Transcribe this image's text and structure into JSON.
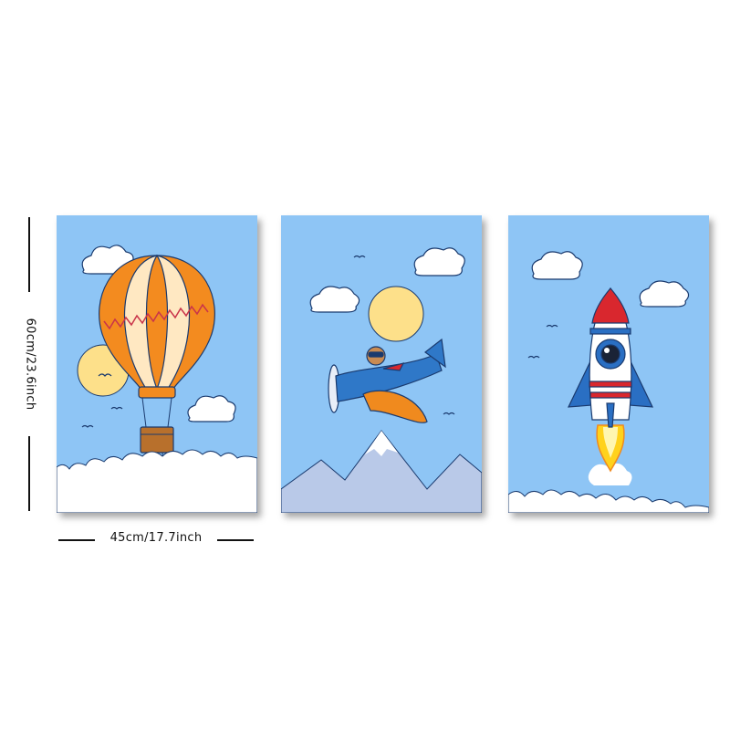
{
  "dimensions": {
    "width_label": "45cm/17.7inch",
    "height_label": "60cm/23.6inch"
  },
  "panels": [
    {
      "subject": "hot-air-balloon"
    },
    {
      "subject": "airplane-pilot"
    },
    {
      "subject": "rocket"
    }
  ],
  "colors": {
    "sky": "#8ec5f5",
    "cloud_outline": "#1a3a6e",
    "sun": "#fde08a",
    "balloon_orange": "#f38b1f",
    "balloon_cream": "#ffe8c2",
    "plane_blue": "#2f78c8",
    "plane_orange": "#f08a1e",
    "mountain": "#b9c9e8",
    "rocket_red": "#d9272e",
    "rocket_blue": "#2a6fc3",
    "flame": "#ffd21c"
  }
}
